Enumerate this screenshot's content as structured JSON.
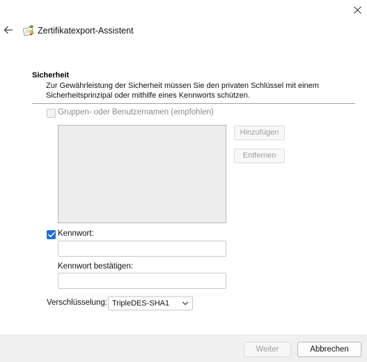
{
  "window": {
    "title": "Zertifikatexport-Assistent"
  },
  "icons": {
    "close": "close-icon",
    "back": "back-arrow-icon",
    "app": "certificate-icon"
  },
  "security": {
    "heading": "Sicherheit",
    "description": "Zur Gewährleistung der Sicherheit müssen Sie den privaten Schlüssel mit einem Sicherheitsprinzipal oder mithilfe eines Kennworts schützen."
  },
  "principals": {
    "checkbox_label": "Gruppen- oder Benutzernamen (empfohlen)",
    "checked": false,
    "enabled": false,
    "add_button": "Hinzufügen",
    "remove_button": "Entfernen",
    "entries": []
  },
  "password": {
    "checkbox_label": "Kennwort:",
    "checked": true,
    "value": "",
    "confirm_label": "Kennwort bestätigen:",
    "confirm_value": ""
  },
  "encryption": {
    "label": "Verschlüsselung:",
    "selected": "TripleDES-SHA1"
  },
  "footer": {
    "next_button": "Weiter",
    "next_enabled": false,
    "cancel_button": "Abbrechen"
  },
  "colors": {
    "accent": "#1f6fd0",
    "footer_bg": "#f0f0f0",
    "listbox_bg": "#ededed"
  }
}
